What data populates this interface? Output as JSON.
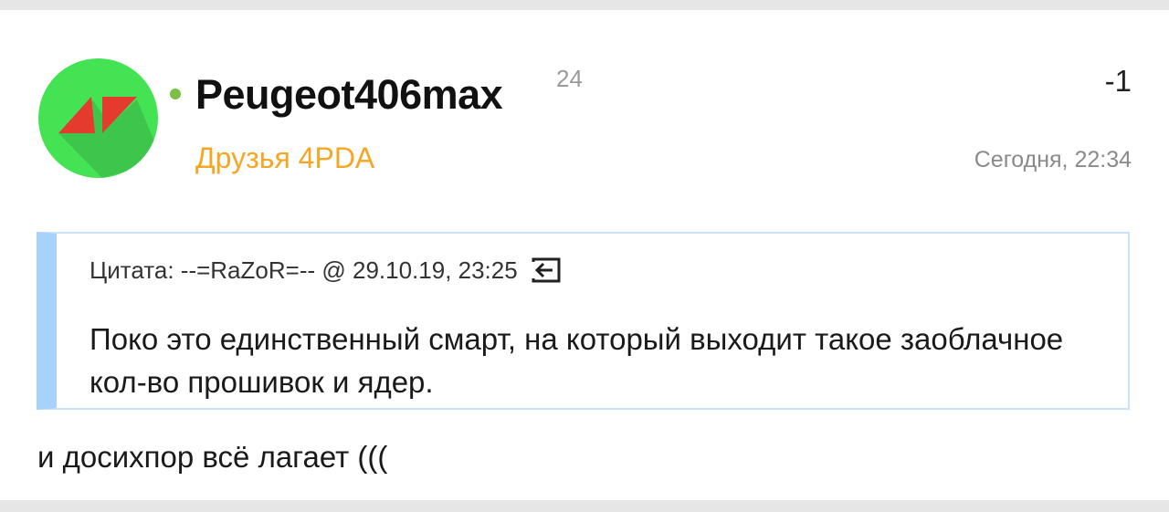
{
  "post": {
    "author": {
      "username": "Peugeot406max",
      "reputation": "24",
      "group": "Друзья 4PDA",
      "online_color": "#7cbf46",
      "group_color": "#f5a623",
      "avatar_bg": "#43e354",
      "avatar_icon": "red-kite-logo-icon"
    },
    "post_number": "-1",
    "date": "Сегодня, 22:34",
    "quote": {
      "header": "Цитата: --=RaZoR=-- @ 29.10.19, 23:25",
      "jump_icon": "goto-quote-icon",
      "text": "Поко это единственный смарт, на который выходит такое заоблачное кол-во прошивок и ядер."
    },
    "text": "и досихпор всё лагает ((("
  }
}
